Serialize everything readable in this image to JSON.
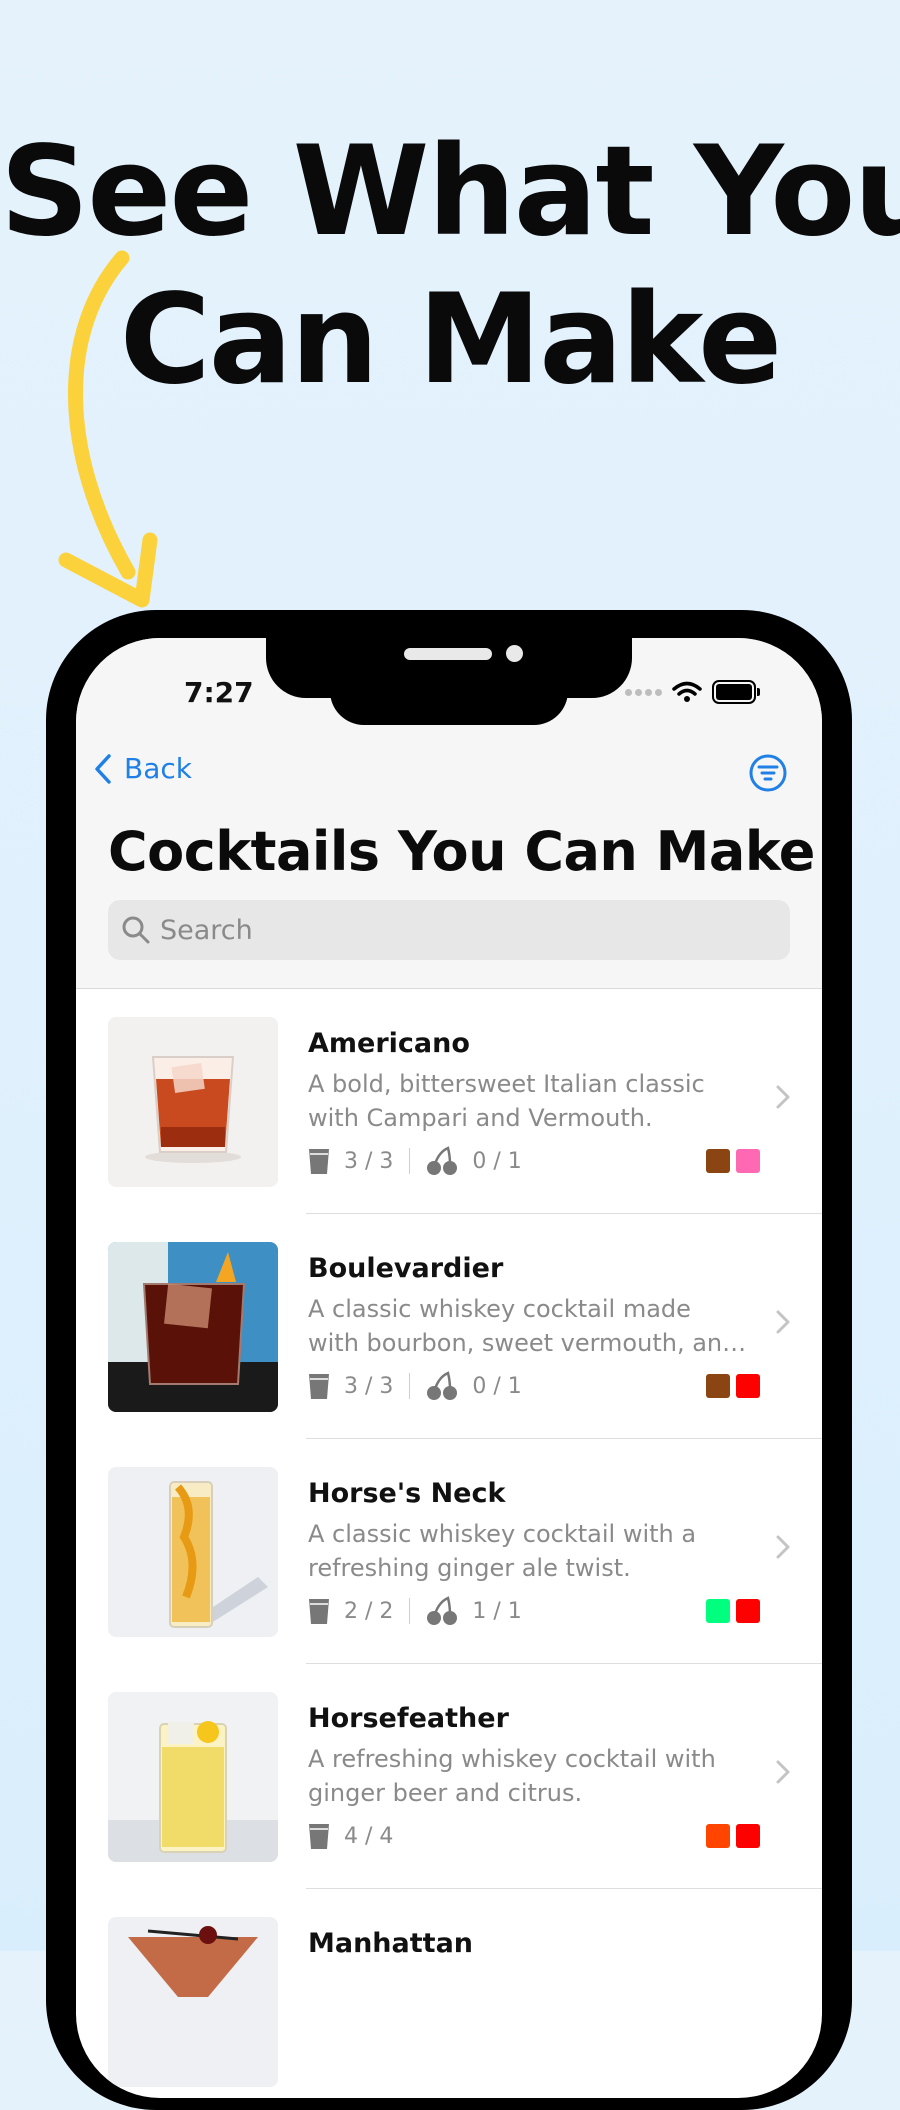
{
  "headline": {
    "line1": "See What You",
    "line2": "Can Make"
  },
  "status_bar": {
    "time": "7:27"
  },
  "nav": {
    "back_label": "Back"
  },
  "page_title": "Cocktails You Can Make",
  "search": {
    "placeholder": "Search"
  },
  "cocktails": [
    {
      "name": "Americano",
      "description": "A bold, bittersweet Italian classic with Campari and Vermouth.",
      "spirits": "3 / 3",
      "garnish": "0 / 1",
      "colors": [
        "#8b4513",
        "#ff69b4"
      ]
    },
    {
      "name": "Boulevardier",
      "description": "A classic whiskey cocktail made with bourbon, sweet vermouth, and Camp...",
      "spirits": "3 / 3",
      "garnish": "0 / 1",
      "colors": [
        "#8b4513",
        "#ff0000"
      ]
    },
    {
      "name": "Horse's Neck",
      "description": "A classic whiskey cocktail with a refreshing ginger ale twist.",
      "spirits": "2 / 2",
      "garnish": "1 / 1",
      "colors": [
        "#00ff7f",
        "#ff0000"
      ]
    },
    {
      "name": "Horsefeather",
      "description": "A refreshing whiskey cocktail with ginger beer and citrus.",
      "spirits": "4 / 4",
      "garnish": "",
      "colors": [
        "#ff4500",
        "#ff0000"
      ]
    },
    {
      "name": "Manhattan",
      "description": "",
      "spirits": "",
      "garnish": "",
      "colors": []
    }
  ],
  "icons": {
    "back": "chevron-left-icon",
    "filter": "filter-icon",
    "search": "magnifier-icon",
    "glass": "glass-icon",
    "garnish": "cherry-icon",
    "disclosure": "chevron-right-icon"
  }
}
